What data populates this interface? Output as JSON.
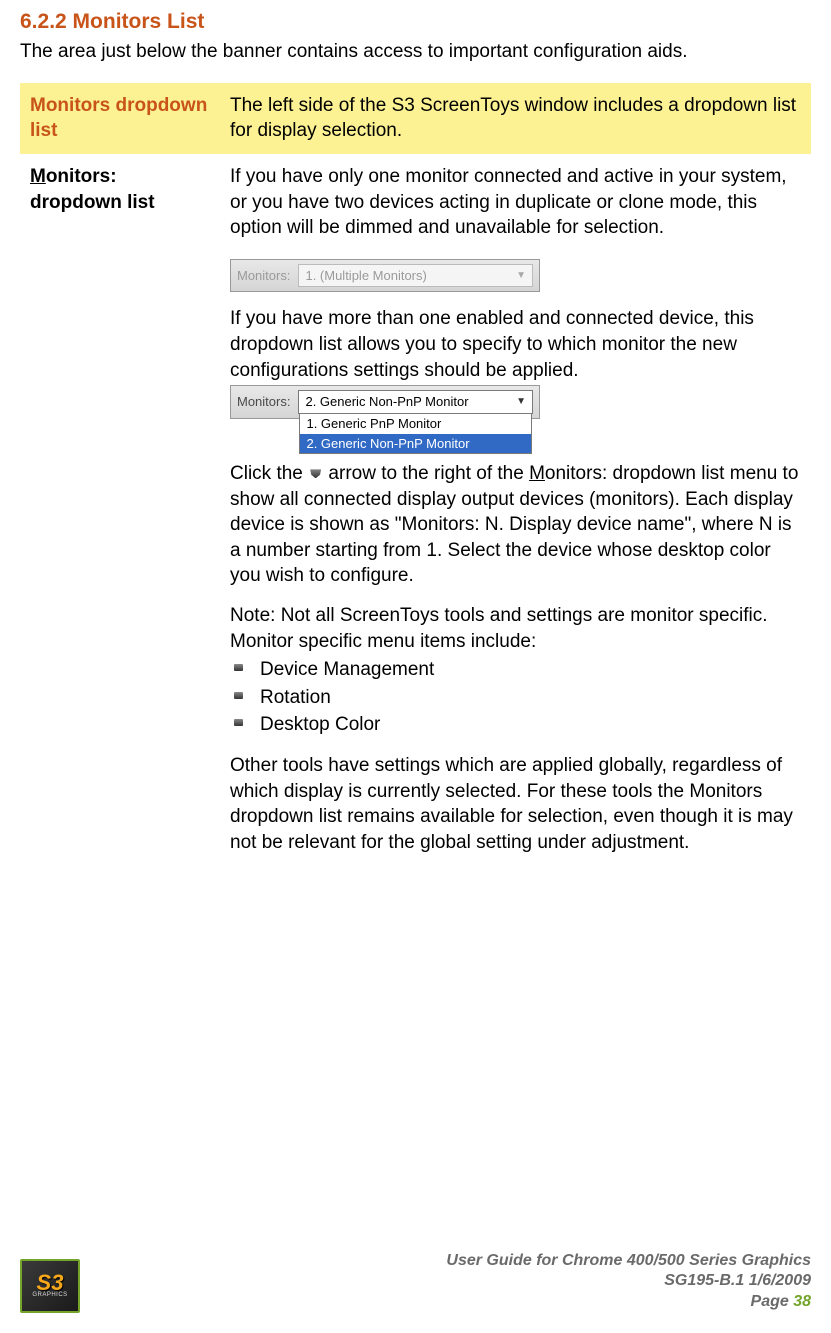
{
  "heading": "6.2.2 Monitors List",
  "intro": "The area just below the banner contains access to important configuration aids.",
  "rows": {
    "hl_label": "Monitors dropdown list",
    "hl_desc": "The left side of the S3 ScreenToys window includes a dropdown list for display selection.",
    "r2_label_u": "M",
    "r2_label_rest": "onitors: dropdown list",
    "p1": "If you have only one monitor connected and active in your system, or you have two devices acting in duplicate or clone mode, this option will be dimmed and unavailable for selection.",
    "dd_dis_label": "Monitors:",
    "dd_dis_value": "1. (Multiple Monitors)",
    "p2": "If you have more than one enabled and connected device, this dropdown list allows you to specify to which monitor the new configurations settings should be applied.",
    "dd_act_label": "Monitors:",
    "dd_act_value": "2. Generic Non-PnP Monitor",
    "dd_opt1": "1. Generic PnP Monitor",
    "dd_opt2": "2. Generic Non-PnP Monitor",
    "p3a": "Click the ",
    "p3b_pre": " arrow to the right of the ",
    "p3b_u": "M",
    "p3b_rest": "onitors",
    "p3c": ": dropdown list menu to show all connected display output devices (monitors). Each display device is shown as \"Monitors: N. Display device name\", where N is a number starting from 1. Select the device whose desktop color you wish to configure.",
    "p4": "Note: Not all ScreenToys tools and settings are monitor specific. Monitor specific menu items include:",
    "bullets": [
      "Device Management",
      "Rotation",
      "Desktop Color"
    ],
    "p5": "Other tools have settings which are applied globally, regardless of which display is currently selected. For these tools the Monitors dropdown list remains available for selection, even though it is may not be relevant for the global setting under adjustment."
  },
  "footer": {
    "logo_main": "S3",
    "logo_sub": "GRAPHICS",
    "line1": "User Guide for Chrome 400/500 Series Graphics",
    "line2": "SG195-B.1   1/6/2009",
    "page_label": "Page ",
    "page_num": "38"
  }
}
